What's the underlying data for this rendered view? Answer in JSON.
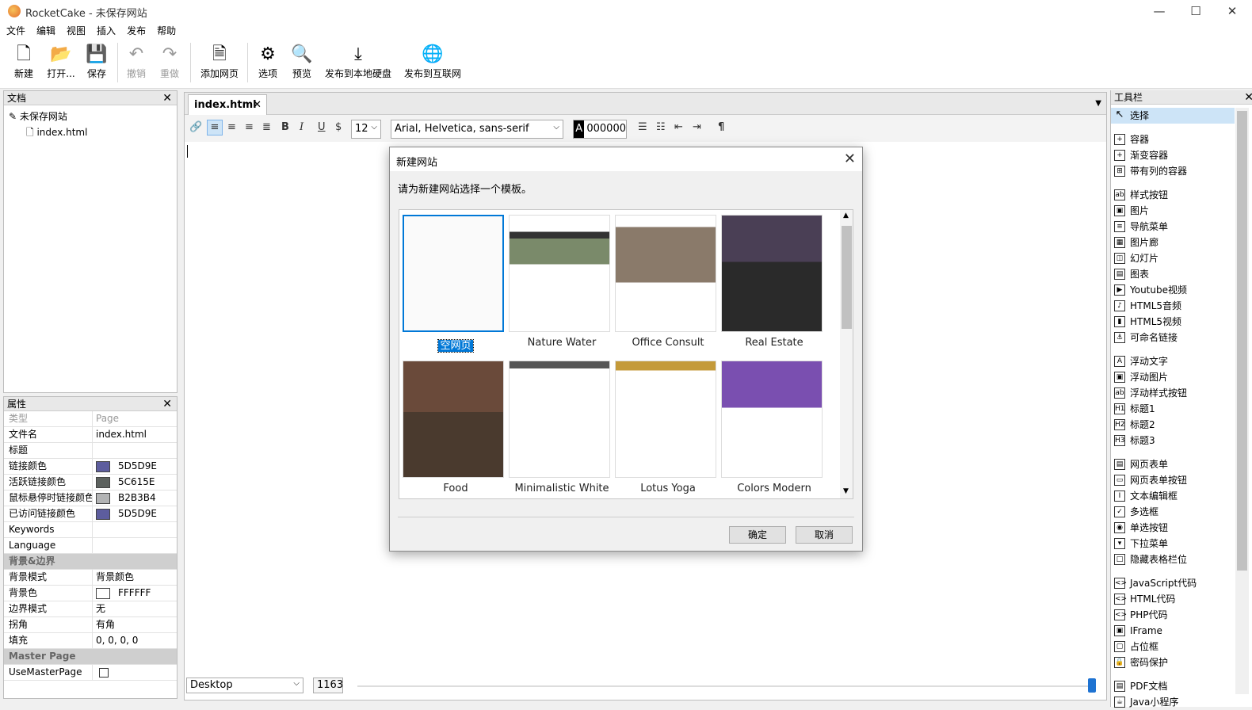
{
  "window": {
    "title": "RocketCake - 未保存网站"
  },
  "menu": [
    "文件",
    "编辑",
    "视图",
    "插入",
    "发布",
    "帮助"
  ],
  "toolbar": {
    "new": "新建",
    "open": "打开...",
    "save": "保存",
    "undo": "撤销",
    "redo": "重做",
    "add_page": "添加网页",
    "options": "选项",
    "preview": "预览",
    "publish_local": "发布到本地硬盘",
    "publish_web": "发布到互联网"
  },
  "doc_panel": {
    "title": "文档",
    "site": "未保存网站",
    "file": "index.html"
  },
  "props": {
    "title": "属性",
    "rows": [
      {
        "k": "类型",
        "v": "Page",
        "gray": true
      },
      {
        "k": "文件名",
        "v": "index.html"
      },
      {
        "k": "标题",
        "v": ""
      },
      {
        "k": "链接颜色",
        "v": "5D5D9E",
        "color": "#5d5d9e"
      },
      {
        "k": "活跃链接颜色",
        "v": "5C615E",
        "color": "#5c615e"
      },
      {
        "k": "鼠标悬停时链接颜色",
        "v": "B2B3B4",
        "color": "#b2b3b4"
      },
      {
        "k": "已访问链接颜色",
        "v": "5D5D9E",
        "color": "#5d5d9e"
      },
      {
        "k": "Keywords",
        "v": ""
      },
      {
        "k": "Language",
        "v": ""
      },
      {
        "cat": "背景&边界"
      },
      {
        "k": "背景模式",
        "v": "背景颜色"
      },
      {
        "k": "背景色",
        "v": "FFFFFF",
        "color": "#ffffff"
      },
      {
        "k": "边界模式",
        "v": "无"
      },
      {
        "k": "拐角",
        "v": "有角"
      },
      {
        "k": "填充",
        "v": "0, 0, 0, 0"
      },
      {
        "cat": "Master Page"
      },
      {
        "k": "UseMasterPage",
        "v": "",
        "check": true
      }
    ]
  },
  "editor": {
    "tab": "index.html",
    "font_size": "12",
    "font_family": "Arial, Helvetica, sans-serif",
    "color_letter": "A",
    "color": "000000",
    "view": "Desktop",
    "width": "1163"
  },
  "dialog": {
    "title": "新建网站",
    "prompt": "请为新建网站选择一个模板。",
    "ok": "确定",
    "cancel": "取消",
    "templates": [
      "空网页",
      "Nature Water",
      "Office Consult",
      "Real Estate",
      "Food",
      "Minimalistic White",
      "Lotus Yoga",
      "Colors Modern"
    ]
  },
  "tools": {
    "title": "工具栏",
    "groups": [
      [
        {
          "l": "选择",
          "i": "↖",
          "sel": true
        }
      ],
      [
        {
          "l": "容器",
          "i": "+"
        },
        {
          "l": "渐变容器",
          "i": "+"
        },
        {
          "l": "带有列的容器",
          "i": "⊞"
        }
      ],
      [
        {
          "l": "样式按钮",
          "i": "ab"
        },
        {
          "l": "图片",
          "i": "▣"
        },
        {
          "l": "导航菜单",
          "i": "≡"
        },
        {
          "l": "图片廊",
          "i": "▦"
        },
        {
          "l": "幻灯片",
          "i": "◫"
        },
        {
          "l": "图表",
          "i": "▤"
        },
        {
          "l": "Youtube视频",
          "i": "▶"
        },
        {
          "l": "HTML5音频",
          "i": "♪"
        },
        {
          "l": "HTML5视频",
          "i": "▮"
        },
        {
          "l": "可命名链接",
          "i": "⚓"
        }
      ],
      [
        {
          "l": "浮动文字",
          "i": "A"
        },
        {
          "l": "浮动图片",
          "i": "▣"
        },
        {
          "l": "浮动样式按钮",
          "i": "ab"
        },
        {
          "l": "标题1",
          "i": "H1"
        },
        {
          "l": "标题2",
          "i": "H2"
        },
        {
          "l": "标题3",
          "i": "H3"
        }
      ],
      [
        {
          "l": "网页表单",
          "i": "▤"
        },
        {
          "l": "网页表单按钮",
          "i": "▭"
        },
        {
          "l": "文本编辑框",
          "i": "I"
        },
        {
          "l": "多选框",
          "i": "✓"
        },
        {
          "l": "单选按钮",
          "i": "◉"
        },
        {
          "l": "下拉菜单",
          "i": "▾"
        },
        {
          "l": "隐藏表格栏位",
          "i": "□"
        }
      ],
      [
        {
          "l": "JavaScript代码",
          "i": "<>"
        },
        {
          "l": "HTML代码",
          "i": "<>"
        },
        {
          "l": "PHP代码",
          "i": "<>"
        },
        {
          "l": "IFrame",
          "i": "▣"
        },
        {
          "l": "占位框",
          "i": "▢"
        },
        {
          "l": "密码保护",
          "i": "🔒"
        }
      ],
      [
        {
          "l": "PDF文档",
          "i": "▤"
        },
        {
          "l": "Java小程序",
          "i": "☕"
        }
      ]
    ]
  }
}
